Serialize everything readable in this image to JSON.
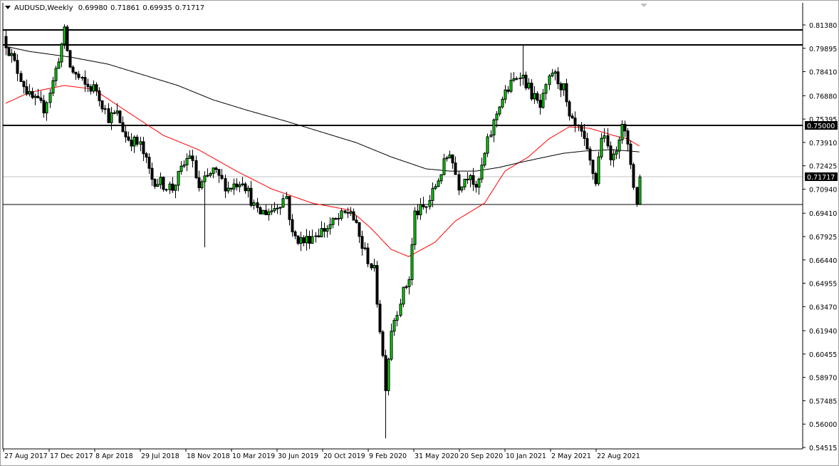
{
  "header": {
    "symbol_timeframe": "AUDUSD,Weekly",
    "open": "0.69980",
    "high": "0.71861",
    "low": "0.69935",
    "close": "0.71717"
  },
  "colors": {
    "bull_fill": "#00e000",
    "bear_fill": "#000000",
    "ma_fast": "#ff0000",
    "ma_slow": "#000000",
    "bid_line": "#c0c0c0"
  },
  "chart_data": {
    "type": "candlestick",
    "title": "AUDUSD,Weekly",
    "ylim": [
      0.54515,
      0.8138
    ],
    "y_ticks": [
      "0.81380",
      "0.79895",
      "0.78410",
      "0.76880",
      "0.75395",
      "0.73910",
      "0.72425",
      "0.70940",
      "0.69410",
      "0.67925",
      "0.66440",
      "0.64955",
      "0.63470",
      "0.61940",
      "0.60455",
      "0.58970",
      "0.57485",
      "0.56000",
      "0.54515"
    ],
    "x_ticks": [
      "27 Aug 2017",
      "17 Dec 2017",
      "8 Apr 2018",
      "29 Jul 2018",
      "18 Nov 2018",
      "10 Mar 2019",
      "30 Jun 2019",
      "20 Oct 2019",
      "9 Feb 2020",
      "31 May 2020",
      "20 Sep 2020",
      "10 Jan 2021",
      "2 May 2021",
      "22 Aug 2021"
    ],
    "weeks": 218,
    "close_path": [
      [
        0,
        0.8025
      ],
      [
        3,
        0.789
      ],
      [
        8,
        0.768
      ],
      [
        13,
        0.761
      ],
      [
        16,
        0.7775
      ],
      [
        20,
        0.809
      ],
      [
        22,
        0.7866
      ],
      [
        27,
        0.775
      ],
      [
        31,
        0.773
      ],
      [
        35,
        0.755
      ],
      [
        38,
        0.757
      ],
      [
        41,
        0.743
      ],
      [
        46,
        0.737
      ],
      [
        50,
        0.716
      ],
      [
        57,
        0.71
      ],
      [
        63,
        0.732
      ],
      [
        66,
        0.71
      ],
      [
        71,
        0.721
      ],
      [
        76,
        0.71
      ],
      [
        81,
        0.716
      ],
      [
        86,
        0.694
      ],
      [
        91,
        0.696
      ],
      [
        96,
        0.705
      ],
      [
        98,
        0.68
      ],
      [
        102,
        0.676
      ],
      [
        105,
        0.68
      ],
      [
        110,
        0.685
      ],
      [
        118,
        0.696
      ],
      [
        122,
        0.673
      ],
      [
        126,
        0.657
      ],
      [
        130,
        0.585
      ],
      [
        132,
        0.621
      ],
      [
        135,
        0.639
      ],
      [
        138,
        0.653
      ],
      [
        140,
        0.694
      ],
      [
        144,
        0.698
      ],
      [
        148,
        0.716
      ],
      [
        152,
        0.734
      ],
      [
        155,
        0.712
      ],
      [
        159,
        0.721
      ],
      [
        161,
        0.707
      ],
      [
        165,
        0.739
      ],
      [
        169,
        0.764
      ],
      [
        172,
        0.773
      ],
      [
        176,
        0.784
      ],
      [
        180,
        0.77
      ],
      [
        183,
        0.761
      ],
      [
        187,
        0.784
      ],
      [
        191,
        0.773
      ],
      [
        193,
        0.753
      ],
      [
        197,
        0.744
      ],
      [
        202,
        0.714
      ],
      [
        204,
        0.744
      ],
      [
        208,
        0.728
      ],
      [
        211,
        0.753
      ],
      [
        214,
        0.726
      ],
      [
        216,
        0.6998
      ]
    ],
    "last_candle": {
      "open": 0.6998,
      "high": 0.71861,
      "low": 0.69935,
      "close": 0.71717
    },
    "extremes": [
      {
        "week": 21,
        "high": 0.8138
      },
      {
        "week": 68,
        "low": 0.6724
      },
      {
        "week": 130,
        "low": 0.551
      },
      {
        "week": 177,
        "high": 0.8011
      }
    ],
    "series": [
      {
        "name": "MA fast (red)",
        "color": "#ff0000",
        "points": [
          [
            0,
            0.764
          ],
          [
            8,
            0.7708
          ],
          [
            20,
            0.7753
          ],
          [
            30,
            0.773
          ],
          [
            41,
            0.7594
          ],
          [
            54,
            0.7436
          ],
          [
            66,
            0.7345
          ],
          [
            79,
            0.7209
          ],
          [
            91,
            0.7096
          ],
          [
            105,
            0.7005
          ],
          [
            118,
            0.696
          ],
          [
            125,
            0.6847
          ],
          [
            132,
            0.6711
          ],
          [
            138,
            0.6665
          ],
          [
            147,
            0.6756
          ],
          [
            154,
            0.6892
          ],
          [
            164,
            0.7005
          ],
          [
            171,
            0.7209
          ],
          [
            179,
            0.7299
          ],
          [
            186,
            0.7413
          ],
          [
            193,
            0.749
          ],
          [
            200,
            0.7481
          ],
          [
            208,
            0.7436
          ],
          [
            213,
            0.7413
          ],
          [
            217,
            0.7368
          ]
        ]
      },
      {
        "name": "MA slow (black)",
        "color": "#000000",
        "points": [
          [
            0,
            0.8002
          ],
          [
            8,
            0.797
          ],
          [
            22,
            0.7934
          ],
          [
            35,
            0.7889
          ],
          [
            47,
            0.7821
          ],
          [
            59,
            0.7753
          ],
          [
            71,
            0.7662
          ],
          [
            83,
            0.7594
          ],
          [
            96,
            0.7526
          ],
          [
            108,
            0.7458
          ],
          [
            120,
            0.739
          ],
          [
            132,
            0.7299
          ],
          [
            144,
            0.7223
          ],
          [
            152,
            0.7209
          ],
          [
            161,
            0.7209
          ],
          [
            169,
            0.7232
          ],
          [
            176,
            0.7263
          ],
          [
            183,
            0.7291
          ],
          [
            191,
            0.7322
          ],
          [
            198,
            0.7336
          ],
          [
            208,
            0.7345
          ],
          [
            217,
            0.7331
          ]
        ]
      }
    ],
    "horizontal_lines": [
      {
        "price": 0.8106,
        "style": "thick"
      },
      {
        "price": 0.8011,
        "style": "thick"
      },
      {
        "price": 0.75,
        "style": "thick",
        "label": "0.75000"
      },
      {
        "price": 0.6995,
        "style": "thin"
      }
    ],
    "bid": {
      "price": 0.71717,
      "label": "0.71717"
    }
  }
}
